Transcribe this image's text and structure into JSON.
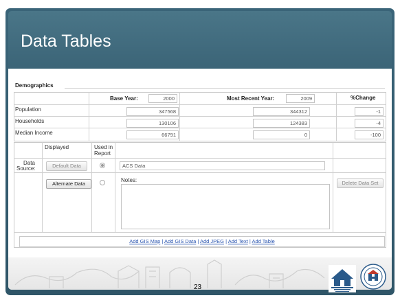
{
  "slide": {
    "title": "Data Tables",
    "page_number": "23"
  },
  "demographics": {
    "section_title": "Demographics",
    "base_year_label": "Base Year:",
    "base_year_value": "2000",
    "recent_year_label": "Most Recent Year:",
    "recent_year_value": "2009",
    "change_label": "%Change",
    "rows": [
      {
        "label": "Population",
        "base": "347568",
        "recent": "344312",
        "change": "-1"
      },
      {
        "label": "Households",
        "base": "130106",
        "recent": "124383",
        "change": "-4"
      },
      {
        "label": "Median Income",
        "base": "66791",
        "recent": "0",
        "change": "-100"
      }
    ]
  },
  "source_table": {
    "col_displayed": "Displayed",
    "col_used_line1": "Used in",
    "col_used_line2": "Report",
    "data_source_line1": "Data",
    "data_source_line2": "Source:",
    "default_button": "Default Data",
    "source_value": "ACS Data",
    "alternate_button": "Alternate Data",
    "notes_label": "Notes:",
    "delete_button": "Delete Data Set",
    "default_radio_selected": true,
    "alternate_radio_selected": false
  },
  "links": {
    "items": [
      "Add GIS Map",
      "Add GIS Data",
      "Add JPEG",
      "Add Text",
      "Add Table"
    ],
    "separator": "|"
  },
  "colors": {
    "title_band": "#3b6477",
    "frame": "#2f5568",
    "link": "#2a55b0"
  },
  "icons": {
    "left_logo": "community-planning-development-logo",
    "right_logo": "hud-seal-logo"
  }
}
